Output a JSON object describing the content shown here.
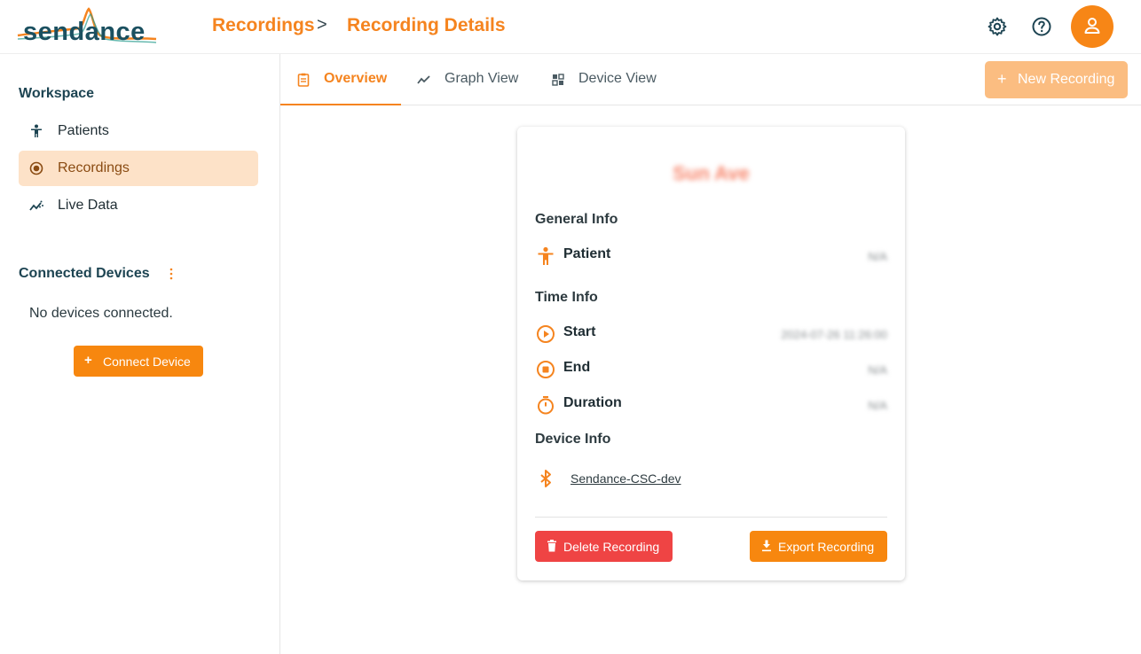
{
  "header": {
    "logo_text": "sendance",
    "breadcrumb": [
      "Recordings",
      "Recording Details"
    ],
    "breadcrumb_separator": ">",
    "icons": [
      "gear-icon",
      "help-circle-icon",
      "user-icon"
    ]
  },
  "sidebar": {
    "workspace_title": "Workspace",
    "items": [
      {
        "label": "Patients",
        "icon": "person-icon",
        "active": false
      },
      {
        "label": "Recordings",
        "icon": "record-icon",
        "active": true
      },
      {
        "label": "Live Data",
        "icon": "trend-icon",
        "active": false
      }
    ],
    "connected_devices_title": "Connected Devices",
    "no_devices_text": "No devices connected.",
    "connect_button": "Connect Device"
  },
  "tabs": {
    "items": [
      {
        "label": "Overview",
        "icon": "document-icon",
        "active": true
      },
      {
        "label": "Graph View",
        "icon": "graph-icon",
        "active": false
      },
      {
        "label": "Device View",
        "icon": "device-grid-icon",
        "active": false
      }
    ],
    "new_recording_button": "New Recording"
  },
  "card": {
    "title": "Sun Ave",
    "general_info": "General Info",
    "patient_label": "Patient",
    "patient_value": "N/A",
    "time_info": "Time Info",
    "start_label": "Start",
    "start_value": "2024-07-26 11:26:00",
    "end_label": "End",
    "end_value": "N/A",
    "duration_label": "Duration",
    "duration_value": "N/A",
    "device_info": "Device Info",
    "device_name": "Sendance-CSC-dev",
    "delete_button": "Delete Recording",
    "export_button": "Export Recording"
  },
  "colors": {
    "accent": "#f5841f",
    "primary_button": "#f7870f",
    "danger": "#ef4444",
    "active_nav_bg": "#fde2c8",
    "disabled_button": "#fbbd81",
    "dark_text": "#1d4452"
  }
}
